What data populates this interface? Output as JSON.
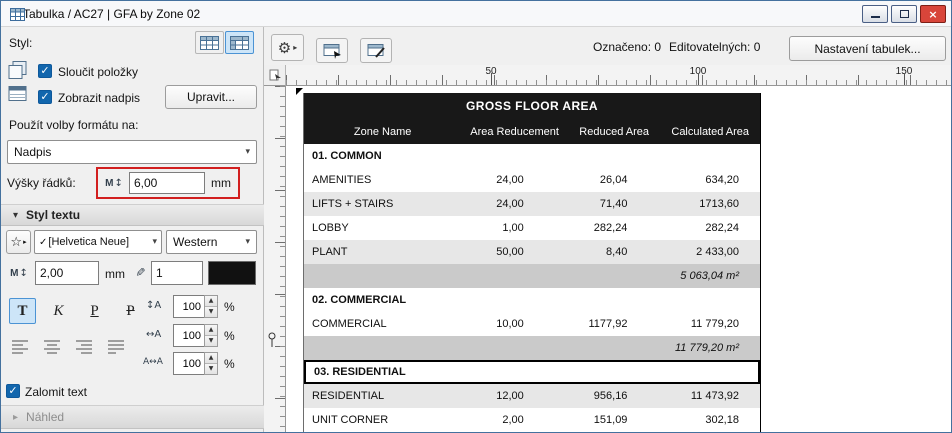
{
  "window": {
    "title": "Tabulka / AC27 | GFA by Zone 02"
  },
  "left_panel": {
    "style_label": "Styl:",
    "merge_label": "Sloučit položky",
    "title_label": "Zobrazit nadpis",
    "edit_button": "Upravit...",
    "format_scope_label": "Použít volby formátu na:",
    "format_scope_value": "Nadpis",
    "row_height": {
      "label": "Výšky řádků:",
      "value": "6,00",
      "unit": "mm"
    },
    "text_style": {
      "header": "Styl textu",
      "font_name": "[Helvetica Neue]",
      "script": "Western",
      "size_value": "2,00",
      "size_unit": "mm",
      "pen_value": "1",
      "bold": "T",
      "italic": "K",
      "underline": "P",
      "strikethrough": "P",
      "spacing": [
        {
          "value": "100",
          "unit": "%"
        },
        {
          "value": "100",
          "unit": "%"
        },
        {
          "value": "100",
          "unit": "%"
        }
      ]
    },
    "wrap_label": "Zalomit text",
    "preview_label": "Náhled"
  },
  "toolbar": {
    "selected_count": "Označeno: 0",
    "editable_count": "Editovatelných: 0",
    "settings_button": "Nastavení tabulek..."
  },
  "ruler": {
    "marks": [
      "50",
      "100",
      "150"
    ]
  },
  "table": {
    "title": "GROSS FLOOR AREA",
    "columns": [
      "Zone Name",
      "Area Reducement",
      "Reduced Area",
      "Calculated Area"
    ],
    "rows": [
      {
        "type": "group",
        "name": "01. COMMON"
      },
      {
        "type": "data",
        "name": "AMENITIES",
        "area_reducement": "24,00",
        "reduced_area": "26,04",
        "calculated_area": "634,20"
      },
      {
        "type": "data",
        "name": "LIFTS + STAIRS",
        "area_reducement": "24,00",
        "reduced_area": "71,40",
        "calculated_area": "1713,60"
      },
      {
        "type": "data",
        "name": "LOBBY",
        "area_reducement": "1,00",
        "reduced_area": "282,24",
        "calculated_area": "282,24"
      },
      {
        "type": "data",
        "name": "PLANT",
        "area_reducement": "50,00",
        "reduced_area": "8,40",
        "calculated_area": "2 433,00"
      },
      {
        "type": "summary",
        "total": "5 063,04 m²"
      },
      {
        "type": "group",
        "name": "02. COMMERCIAL"
      },
      {
        "type": "data",
        "name": "COMMERCIAL",
        "area_reducement": "10,00",
        "reduced_area": "1177,92",
        "calculated_area": "11 779,20"
      },
      {
        "type": "summary",
        "total": "11 779,20 m²"
      },
      {
        "type": "group",
        "name": "03. RESIDENTIAL",
        "selected": true
      },
      {
        "type": "data",
        "name": "RESIDENTIAL",
        "area_reducement": "12,00",
        "reduced_area": "956,16",
        "calculated_area": "11 473,92"
      },
      {
        "type": "data",
        "name": "UNIT CORNER",
        "area_reducement": "2,00",
        "reduced_area": "151,09",
        "calculated_area": "302,18"
      }
    ]
  },
  "icons": {
    "gear": "⚙",
    "triangle_right": "▸",
    "triangle_down": "▾",
    "chevron_down": "▾",
    "check": "✓",
    "star": "☆",
    "updown": "↕",
    "pen": "✎",
    "close": "×",
    "spin_up": "▲",
    "spin_down": "▼",
    "letter_m": "M",
    "line_spacing": "↕A",
    "char_width": "↔A",
    "char_spacing": "A↔A"
  },
  "colors": {
    "accent_blue": "#1266ad",
    "selection_fill": "#cde5f8",
    "table_header_bg": "#181818",
    "row_shade": "#e7e7e7",
    "summary_shade": "#cacaca",
    "annotation_red": "#d21f1f",
    "close_button_red": "#d8453a"
  }
}
